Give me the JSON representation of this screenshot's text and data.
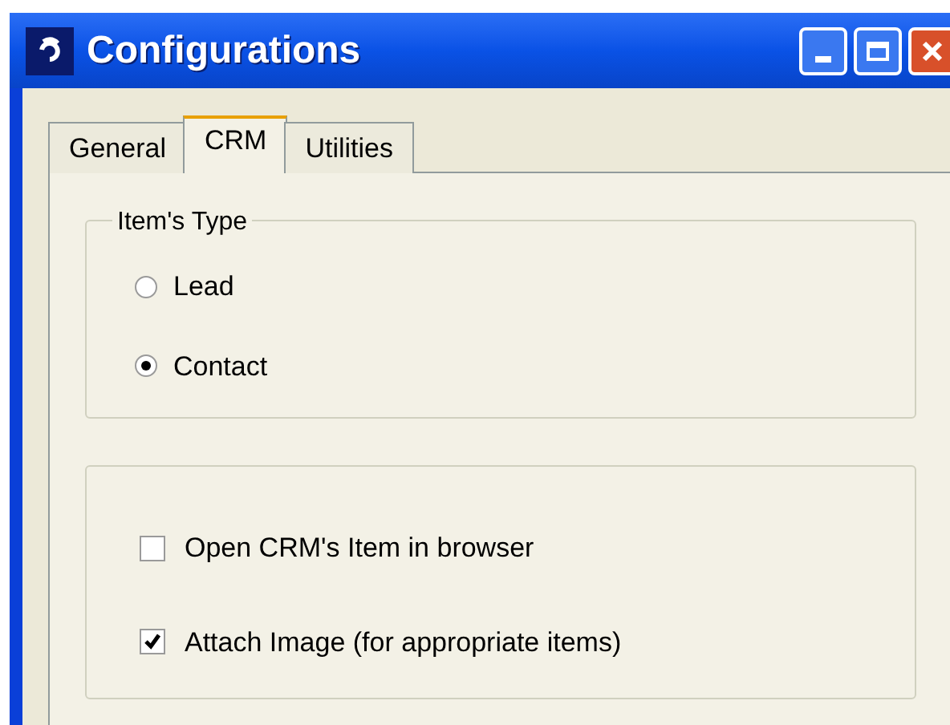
{
  "window": {
    "title": "Configurations"
  },
  "tabs": [
    {
      "label": "General",
      "selected": false
    },
    {
      "label": "CRM",
      "selected": true
    },
    {
      "label": "Utilities",
      "selected": false
    }
  ],
  "item_type": {
    "legend": "Item's Type",
    "options": [
      {
        "label": "Lead",
        "selected": false
      },
      {
        "label": "Contact",
        "selected": true
      }
    ]
  },
  "options": [
    {
      "label": "Open CRM's Item in browser",
      "checked": false
    },
    {
      "label": "Attach Image (for appropriate items)",
      "checked": true
    }
  ]
}
